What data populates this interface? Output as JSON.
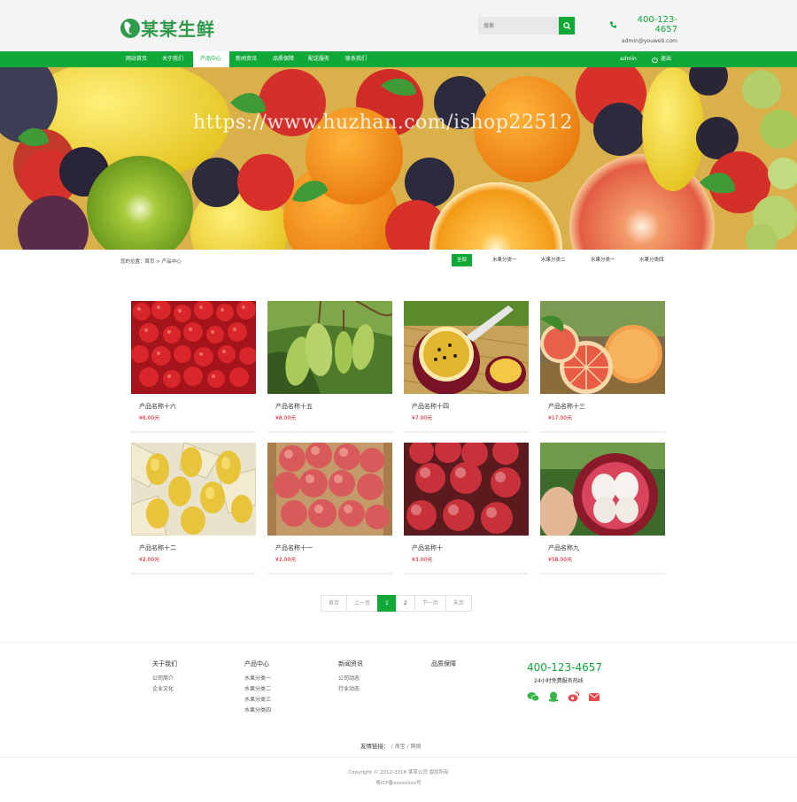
{
  "brand": {
    "name": "某某生鲜",
    "accent": "#11a83a"
  },
  "search": {
    "placeholder": "搜索"
  },
  "contact": {
    "phone": "400-123-4657",
    "email": "admin@youweb.com"
  },
  "nav": {
    "items": [
      "网站首页",
      "关于我们",
      "产品中心",
      "新闻资讯",
      "品质保障",
      "配送服务",
      "联系我们"
    ],
    "active": "产品中心",
    "user": "admin",
    "logout": "退出"
  },
  "banner": {
    "watermark": "https://www.huzhan.com/ishop22512"
  },
  "breadcrumb": {
    "text": "您的位置：首页 > 产品中心"
  },
  "categories": {
    "items": [
      "全部",
      "水果分类一",
      "水果分类二",
      "水果分类一",
      "水果分类四"
    ],
    "active": "全部"
  },
  "products": [
    {
      "name": "产品名称十六",
      "price": "¥6.00元",
      "image": "cherry-tomatoes"
    },
    {
      "name": "产品名称十五",
      "price": "¥8.00元",
      "image": "mangoes"
    },
    {
      "name": "产品名称十四",
      "price": "¥7.00元",
      "image": "passion-fruit"
    },
    {
      "name": "产品名称十三",
      "price": "¥17.00元",
      "image": "grapefruit"
    },
    {
      "name": "产品名称十二",
      "price": "¥2.00元",
      "image": "pears"
    },
    {
      "name": "产品名称十一",
      "price": "¥2.00元",
      "image": "red-apples-box"
    },
    {
      "name": "产品名称十",
      "price": "¥3.00元",
      "image": "apples"
    },
    {
      "name": "产品名称九",
      "price": "¥58.00元",
      "image": "mangosteen"
    }
  ],
  "pagination": {
    "first": "首页",
    "prev": "上一页",
    "pages": [
      "1",
      "2"
    ],
    "current": "1",
    "next": "下一页",
    "last": "末页"
  },
  "footer": {
    "columns": [
      {
        "title": "关于我们",
        "links": [
          "公司简介",
          "企业文化"
        ]
      },
      {
        "title": "产品中心",
        "links": [
          "水果分类一",
          "水果分类二",
          "水果分类三",
          "水果分类四"
        ]
      },
      {
        "title": "新闻资讯",
        "links": [
          "公司动态",
          "行业动态"
        ]
      },
      {
        "title": "品质保障",
        "links": []
      }
    ],
    "phone": "400-123-4657",
    "hotline": "24小时免费服务热线",
    "social_icons": [
      "wechat-icon",
      "qq-icon",
      "weibo-icon",
      "mail-icon"
    ],
    "friend_links_label": "友情链接：",
    "friend_links": [
      "淘宝",
      "网络"
    ],
    "copyright": "Copyright © 2012-2018 某某公司 版权所有",
    "icp": "粤ICP备xxxxxxxx号"
  }
}
